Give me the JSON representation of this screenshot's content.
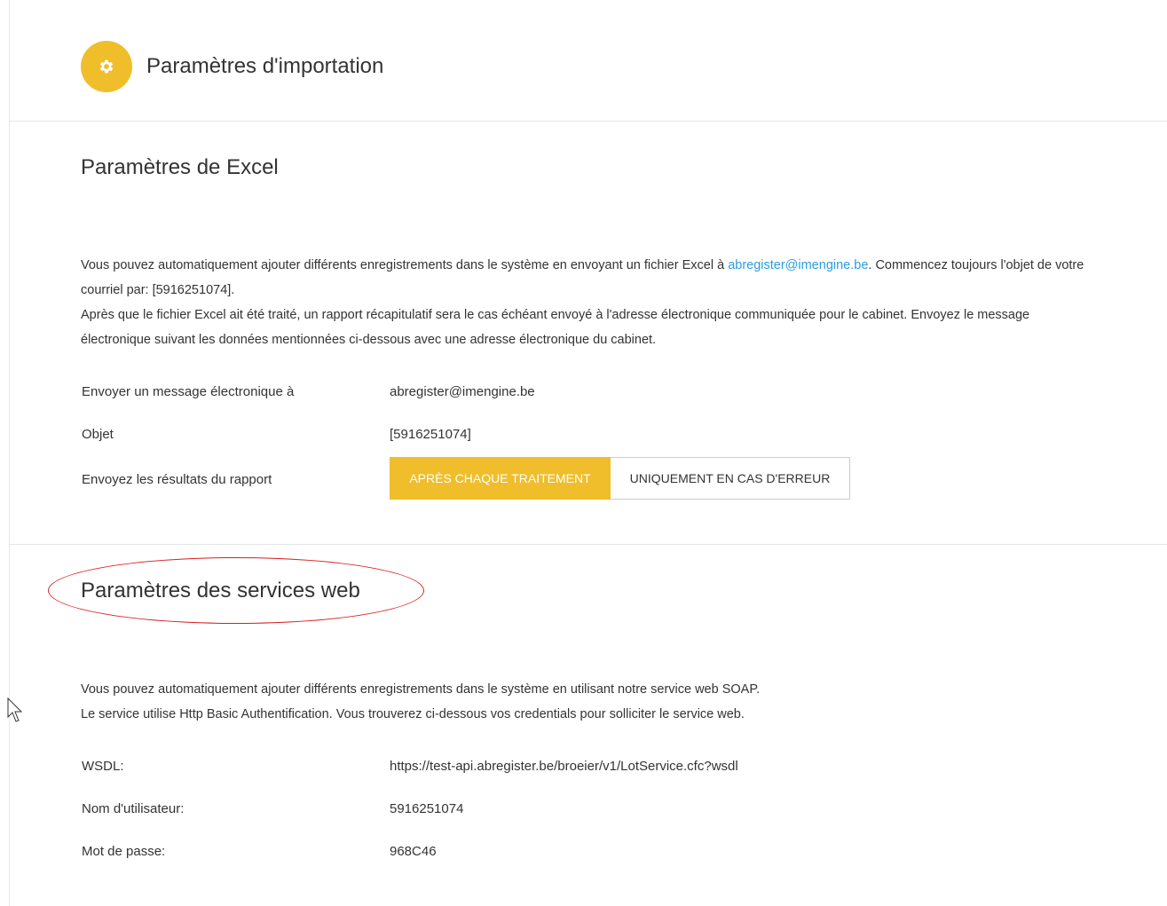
{
  "header": {
    "title": "Paramètres d'importation",
    "icon": "gear-icon",
    "accent_color": "#f0bd2b"
  },
  "excel": {
    "title": "Paramètres de Excel",
    "para1_before": "Vous pouvez automatiquement ajouter différents enregistrements dans le système en envoyant un fichier Excel à ",
    "para1_email": "abregister@imengine.be",
    "para1_after": ". Commencez toujours l'objet de votre courriel par: [5916251074].",
    "para2": "Après que le fichier Excel ait été traité, un rapport récapitulatif sera le cas échéant envoyé à l'adresse électronique communiquée pour le cabinet. Envoyez le message électronique suivant les données mentionnées ci-dessous avec une adresse électronique du cabinet.",
    "rows": {
      "send_to_label": "Envoyer un message électronique à",
      "send_to_value": "abregister@imengine.be",
      "subject_label": "Objet",
      "subject_value": "[5916251074]",
      "report_label": "Envoyez les résultats du rapport"
    },
    "report_options": {
      "after_each": "APRÈS CHAQUE TRAITEMENT",
      "errors_only": "UNIQUEMENT EN CAS D'ERREUR",
      "selected": "APRÈS CHAQUE TRAITEMENT"
    }
  },
  "webservices": {
    "title": "Paramètres des services web",
    "para1": "Vous pouvez automatiquement ajouter différents enregistrements dans le système en utilisant notre service web SOAP.",
    "para2": "Le service utilise Http Basic Authentification. Vous trouverez ci-dessous vos credentials pour solliciter le service web.",
    "rows": {
      "wsdl_label": "WSDL:",
      "wsdl_value": "https://test-api.abregister.be/broeier/v1/LotService.cfc?wsdl",
      "username_label": "Nom d'utilisateur:",
      "username_value": "5916251074",
      "password_label": "Mot de passe:",
      "password_value": "968C46"
    }
  },
  "colors": {
    "link": "#2b9de0",
    "annotation": "#d61f1f"
  }
}
